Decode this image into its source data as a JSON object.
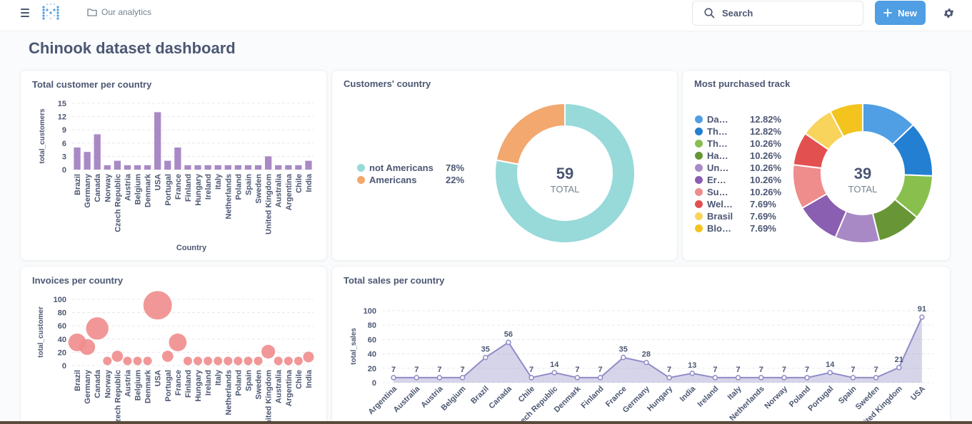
{
  "header": {
    "breadcrumb_label": "Our analytics",
    "search_placeholder": "Search",
    "new_label": "New"
  },
  "page": {
    "title": "Chinook dataset dashboard"
  },
  "colors": {
    "accent": "#509ee3",
    "bar": "#a989c5",
    "bubble": "#ef8c8c",
    "area": "#a3a0cf"
  },
  "cards": {
    "customers_per_country": {
      "title": "Total customer per country"
    },
    "customers_country": {
      "title": "Customers' country"
    },
    "most_purchased": {
      "title": "Most purchased track"
    },
    "invoices": {
      "title": "Invoices per country"
    },
    "sales": {
      "title": "Total sales per country"
    }
  },
  "chart_data": [
    {
      "type": "bar",
      "title": "Total customer per country",
      "xlabel": "Country",
      "ylabel": "total_customers",
      "ylim": [
        0,
        15
      ],
      "yticks": [
        0,
        3,
        6,
        9,
        12,
        15
      ],
      "categories": [
        "Brazil",
        "Germany",
        "Canada",
        "Norway",
        "Czech Republic",
        "Austria",
        "Belgium",
        "Denmark",
        "USA",
        "Portugal",
        "France",
        "Finland",
        "Hungary",
        "Ireland",
        "Italy",
        "Netherlands",
        "Poland",
        "Spain",
        "Sweden",
        "United Kingdom",
        "Australia",
        "Argentina",
        "Chile",
        "India"
      ],
      "values": [
        5,
        4,
        8,
        1,
        2,
        1,
        1,
        1,
        13,
        2,
        5,
        1,
        1,
        1,
        1,
        1,
        1,
        1,
        1,
        3,
        1,
        1,
        1,
        2
      ]
    },
    {
      "type": "pie",
      "title": "Customers' country",
      "total": "59",
      "total_label": "TOTAL",
      "slices": [
        {
          "name": "not Americans",
          "value": 78,
          "label": "78%",
          "color": "#98d9d9"
        },
        {
          "name": "Americans",
          "value": 22,
          "label": "22%",
          "color": "#f2a86f"
        }
      ]
    },
    {
      "type": "pie",
      "title": "Most purchased track",
      "total": "39",
      "total_label": "TOTAL",
      "slices": [
        {
          "name": "Da…",
          "value": 12.82,
          "label": "12.82%",
          "color": "#509ee3"
        },
        {
          "name": "Th…",
          "value": 12.82,
          "label": "12.82%",
          "color": "#227fd2"
        },
        {
          "name": "Th…",
          "value": 10.26,
          "label": "10.26%",
          "color": "#88bf4d"
        },
        {
          "name": "Ha…",
          "value": 10.26,
          "label": "10.26%",
          "color": "#689636"
        },
        {
          "name": "Un…",
          "value": 10.26,
          "label": "10.26%",
          "color": "#a989c5"
        },
        {
          "name": "Er…",
          "value": 10.26,
          "label": "10.26%",
          "color": "#8a5eb0"
        },
        {
          "name": "Su…",
          "value": 10.26,
          "label": "10.26%",
          "color": "#ef8c8c"
        },
        {
          "name": "Wel…",
          "value": 7.69,
          "label": "7.69%",
          "color": "#e35050"
        },
        {
          "name": "Brasil",
          "value": 7.69,
          "label": "7.69%",
          "color": "#f9d45c"
        },
        {
          "name": "Blo…",
          "value": 7.69,
          "label": "7.69%",
          "color": "#f2c41d"
        }
      ]
    },
    {
      "type": "scatter",
      "title": "Invoices per country",
      "ylabel": "total_customer",
      "ylim": [
        0,
        100
      ],
      "yticks": [
        0,
        20,
        40,
        60,
        80,
        100
      ],
      "categories": [
        "Brazil",
        "Germany",
        "Canada",
        "Norway",
        "Czech Republic",
        "Austria",
        "Belgium",
        "Denmark",
        "USA",
        "Portugal",
        "France",
        "Finland",
        "Hungary",
        "Ireland",
        "Italy",
        "Netherlands",
        "Poland",
        "Spain",
        "Sweden",
        "United Kingdom",
        "Australia",
        "Argentina",
        "Chile",
        "India"
      ],
      "values": [
        35,
        28,
        56,
        7,
        14,
        7,
        7,
        7,
        91,
        14,
        35,
        7,
        7,
        7,
        7,
        7,
        7,
        7,
        7,
        21,
        7,
        7,
        7,
        13
      ]
    },
    {
      "type": "area",
      "title": "Total sales per country",
      "ylabel": "total_sales",
      "ylim": [
        0,
        100
      ],
      "yticks": [
        0,
        20,
        40,
        60,
        80,
        100
      ],
      "categories": [
        "Argentina",
        "Australia",
        "Austria",
        "Belgium",
        "Brazil",
        "Canada",
        "Chile",
        "Czech Republic",
        "Denmark",
        "Finland",
        "France",
        "Germany",
        "Hungary",
        "India",
        "Ireland",
        "Italy",
        "Netherlands",
        "Norway",
        "Poland",
        "Portugal",
        "Spain",
        "Sweden",
        "United Kingdom",
        "USA"
      ],
      "values": [
        7,
        7,
        7,
        7,
        35,
        56,
        7,
        14,
        7,
        7,
        35,
        28,
        7,
        13,
        7,
        7,
        7,
        7,
        7,
        14,
        7,
        7,
        21,
        91
      ],
      "value_labels": [
        "7",
        "7",
        "7",
        "7",
        "35",
        "56",
        "7",
        "14",
        "7",
        "7",
        "35",
        "28",
        "7",
        "13",
        "7",
        "7",
        "7",
        "7",
        "7",
        "14",
        "7",
        "7",
        "21",
        "91"
      ]
    }
  ]
}
